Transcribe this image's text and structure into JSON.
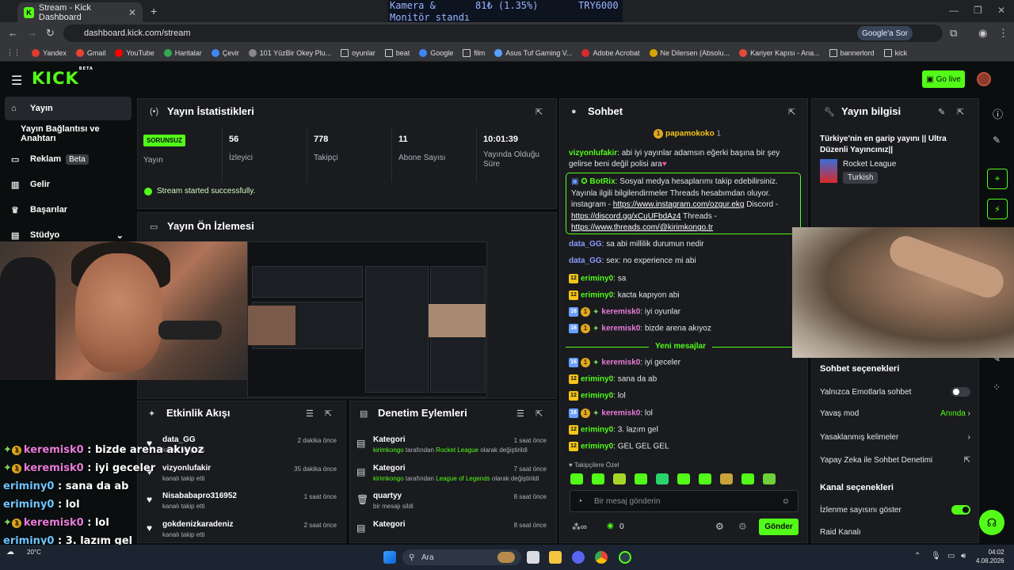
{
  "browser": {
    "tab_title": "Stream - Kick Dashboard",
    "url": "dashboard.kick.com/stream",
    "google_ask": "Google'a Sor",
    "bookmarks": [
      "Yandex",
      "Gmail",
      "YouTube",
      "Haritalar",
      "Çevir",
      "101 YüzBir Okey Plu...",
      "oyunlar",
      "beat",
      "Google",
      "film",
      "Asus Tuf Gaming V...",
      "Adobe Acrobat",
      "Ne Dilersen (Absolu...",
      "Kariyer Kapısı - Ana...",
      "bannerlord",
      "kick"
    ]
  },
  "ticker": {
    "item": "Kamera &",
    "item2": "Monitör standı",
    "change": "81₺ (1.35%)",
    "price": "TRY6000"
  },
  "kick": {
    "logo": "KICK",
    "logo_sup": "BETA",
    "go_live": "Go live"
  },
  "sidebar": {
    "items": [
      {
        "label": "Yayın",
        "icon": "broadcast-icon"
      },
      {
        "label": "Yayın Bağlantısı ve Anahtarı"
      },
      {
        "label": "Reklam",
        "badge": "Beta"
      },
      {
        "label": "Gelir"
      },
      {
        "label": "Başarılar"
      },
      {
        "label": "Stüdyo"
      }
    ]
  },
  "stats": {
    "title": "Yayın İstatistikleri",
    "status_badge": "SORUNSUZ",
    "status_label": "Yayın",
    "items": [
      {
        "value": "56",
        "label": "İzleyici"
      },
      {
        "value": "778",
        "label": "Takipçi"
      },
      {
        "value": "11",
        "label": "Abone Sayısı"
      },
      {
        "value": "10:01:39",
        "label": "Yayında Olduğu Süre"
      }
    ],
    "success": "Stream started successfully."
  },
  "preview": {
    "title": "Yayın Ön İzlemesi"
  },
  "activity": {
    "title": "Etkinlik Akışı",
    "items": [
      {
        "name": "data_GG",
        "sub": "kanalı takip etti",
        "time": "2 dakika önce"
      },
      {
        "name": "vizyonlufakir",
        "sub": "kanalı takip etti",
        "time": "35 dakika önce"
      },
      {
        "name": "Nisababapro316952",
        "sub": "kanalı takip etti",
        "time": "1 saat önce"
      },
      {
        "name": "gokdenizkaradeniz",
        "sub": "kanalı takip etti",
        "time": "2 saat önce"
      }
    ]
  },
  "mod": {
    "title": "Denetim Eylemleri",
    "items": [
      {
        "name": "Kategori",
        "actor": "kirimkongo",
        "mid": " tarafından ",
        "target": "Rocket League",
        "end": " olarak değiştirildi",
        "time": "1 saat önce"
      },
      {
        "name": "Kategori",
        "actor": "kirimkongo",
        "mid": " tarafından ",
        "target": "League of Legends",
        "end": " olarak değiştirildi",
        "time": "7 saat önce"
      },
      {
        "name": "quartyy",
        "sub": "bir mesajı sildi",
        "time": "8 saat önce"
      },
      {
        "name": "Kategori",
        "time": "8 saat önce"
      }
    ]
  },
  "chat": {
    "title": "Sohbet",
    "pinned_user": "papamokoko",
    "pinned_count": "1",
    "messages": [
      {
        "user": "vizyonlufakir",
        "text": ": abi iyi yayınlar adamsın eğerki başına bir şey",
        "text2": "gelirse beni değil polisi ara"
      },
      {
        "user": "data_GG",
        "text": ": sa abi millilik durumun nedir"
      },
      {
        "user": "data_GG",
        "text": ": sex: no experience mi abi"
      },
      {
        "lvl": "12",
        "user": "eriminy0",
        "text": ": sa"
      },
      {
        "lvl": "12",
        "user": "eriminy0",
        "text": ": kacta kapıyon abi"
      },
      {
        "lvl": "16",
        "user": "keremisk0",
        "text": ": iyi oyunlar"
      },
      {
        "lvl": "16",
        "user": "keremisk0",
        "text": ": bizde arena akıyoz"
      },
      {
        "lvl": "16",
        "user": "keremisk0",
        "text": ": iyi geceler"
      },
      {
        "lvl": "12",
        "user": "eriminy0",
        "text": ": sana da ab"
      },
      {
        "lvl": "12",
        "user": "eriminy0",
        "text": ": lol"
      },
      {
        "lvl": "16",
        "user": "keremisk0",
        "text": ": lol"
      },
      {
        "lvl": "12",
        "user": "eriminy0",
        "text": ": 3. lazım gel"
      },
      {
        "lvl": "12",
        "user": "eriminy0",
        "text": ": GEL GEL GEL"
      }
    ],
    "botrix": {
      "name": "BotRix",
      "line1": ": Sosyal medya hesaplarımı takip edebilirsiniz.",
      "line2": "Yayınla ilgili bilgilendirmeler Threads hesabımdan oluyor.",
      "line3a": "instagram - ",
      "link1": "https://www.instagram.com/ozgur.ekg",
      "line3b": " Discord -",
      "link2": "https://discord.gg/xCuUFbdAz4",
      "line4b": " Threads -",
      "link3": "https://www.threads.com/@kirimkongo.tr"
    },
    "new_messages": "Yeni mesajlar",
    "followers_special": "Takipçilere Özel",
    "input_placeholder": "Bir mesaj gönderin",
    "send": "Gönder",
    "kick_count": "0"
  },
  "info": {
    "title": "Yayın bilgisi",
    "stream_title": "Türkiye'nin en garip yayını || Ultra Düzenli Yayıncınız||",
    "category": "Rocket League",
    "tag": "Turkish",
    "chat_options_title": "Sohbet seçenekleri",
    "chat_options": [
      {
        "label": "Yalnızca Emotlarla sohbet",
        "toggle": "off"
      },
      {
        "label": "Yavaş mod",
        "value": "Anında"
      },
      {
        "label": "Yasaklanmış kelimeler"
      },
      {
        "label": "Yapay Zeka ile Sohbet Denetimi"
      }
    ],
    "channel_options_title": "Kanal seçenekleri",
    "channel_options": [
      {
        "label": "İzlenme sayısını göster",
        "toggle": "on"
      },
      {
        "label": "Raid Kanalı"
      }
    ]
  },
  "overlay": [
    {
      "lvl": "1",
      "user": "keremisk0",
      "text": " : bizde arena akıyoz"
    },
    {
      "lvl": "1",
      "user": "keremisk0",
      "text": " : iyi geceler"
    },
    {
      "user": "eriminy0",
      "text": " : sana da ab"
    },
    {
      "user": "eriminy0",
      "text": " : lol"
    },
    {
      "lvl": "1",
      "user": "keremisk0",
      "text": " : lol"
    },
    {
      "user": "eriminy0",
      "text": " : 3. lazım gel"
    },
    {
      "user": "eriminy0",
      "text": " : GEL GEL GEL"
    }
  ],
  "taskbar": {
    "weather": "20°C",
    "search": "Ara",
    "time": "04:02",
    "date": "4.08.2026"
  }
}
